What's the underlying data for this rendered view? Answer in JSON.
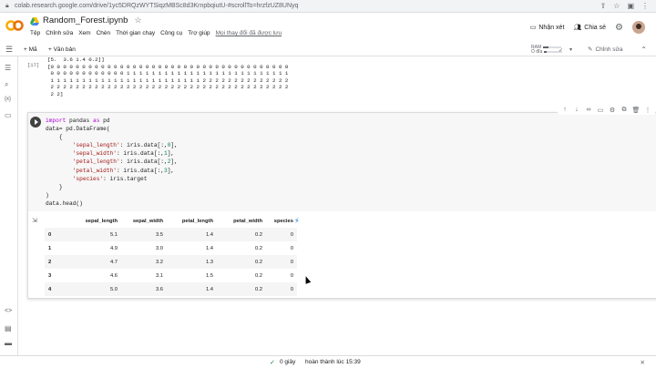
{
  "browser": {
    "url": "colab.research.google.com/drive/1yc5DRQzWYTSiqzMBSc8d3KrnpbqiutU-#scrollTo=hrzfzUZ8UNyq"
  },
  "header": {
    "title": "Random_Forest.ipynb",
    "menu": [
      "Tệp",
      "Chỉnh sửa",
      "Xem",
      "Chèn",
      "Thời gian chạy",
      "Công cụ",
      "Trợ giúp"
    ],
    "changes_note": "Mọi thay đổi đã được lưu",
    "comment_label": "Nhận xét",
    "share_label": "Chia sẻ"
  },
  "toolbar": {
    "add_code": "+ Mã",
    "add_text": "+ Văn bản",
    "ram_label": "RAM",
    "disk_label": "Ổ đĩa",
    "edit_label": "Chỉnh sửa"
  },
  "prev_output": {
    "label": "[17]",
    "lines": [
      "[5.  3.6 1.4 0.2]]",
      "[0 0 0 0 0 0 0 0 0 0 0 0 0 0 0 0 0 0 0 0 0 0 0 0 0 0 0 0 0 0 0 0 0 0 0 0 0 0",
      " 0 0 0 0 0 0 0 0 0 0 0 0 1 1 1 1 1 1 1 1 1 1 1 1 1 1 1 1 1 1 1 1 1 1 1 1 1 1",
      " 1 1 1 1 1 1 1 1 1 1 1 1 1 1 1 1 1 1 1 1 1 1 1 1 2 2 2 2 2 2 2 2 2 2 2 2 2 2",
      " 2 2 2 2 2 2 2 2 2 2 2 2 2 2 2 2 2 2 2 2 2 2 2 2 2 2 2 2 2 2 2 2 2 2 2 2 2 2",
      " 2 2]"
    ]
  },
  "code_cell": {
    "lines": [
      "import pandas as pd",
      "data= pd.DataFrame(",
      "    {",
      "        'sepal_length': iris.data[:,0],",
      "        'sepal_width': iris.data[:,1],",
      "        'petal_length': iris.data[:,2],",
      "        'petal_width': iris.data[:,3],",
      "        'species': iris.target",
      "    }",
      ")",
      "data.head()"
    ]
  },
  "dataframe": {
    "columns": [
      "",
      "sepal_length",
      "sepal_width",
      "petal_length",
      "petal_width",
      "species"
    ],
    "rows": [
      [
        "0",
        "5.1",
        "3.5",
        "1.4",
        "0.2",
        "0"
      ],
      [
        "1",
        "4.9",
        "3.0",
        "1.4",
        "0.2",
        "0"
      ],
      [
        "2",
        "4.7",
        "3.2",
        "1.3",
        "0.2",
        "0"
      ],
      [
        "3",
        "4.6",
        "3.1",
        "1.5",
        "0.2",
        "0"
      ],
      [
        "4",
        "5.0",
        "3.6",
        "1.4",
        "0.2",
        "0"
      ]
    ]
  },
  "status": {
    "elapsed": "0 giây",
    "completed": "hoàn thành lúc 15:39"
  }
}
